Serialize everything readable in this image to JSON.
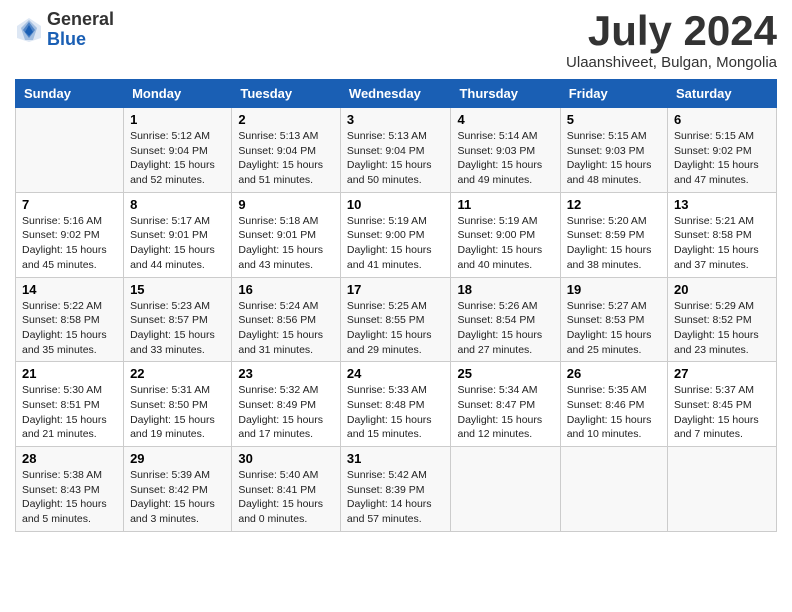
{
  "header": {
    "logo_line1": "General",
    "logo_line2": "Blue",
    "month": "July 2024",
    "location": "Ulaanshiveet, Bulgan, Mongolia"
  },
  "weekdays": [
    "Sunday",
    "Monday",
    "Tuesday",
    "Wednesday",
    "Thursday",
    "Friday",
    "Saturday"
  ],
  "weeks": [
    [
      {
        "num": "",
        "sunrise": "",
        "sunset": "",
        "daylight": "",
        "empty": true
      },
      {
        "num": "1",
        "sunrise": "Sunrise: 5:12 AM",
        "sunset": "Sunset: 9:04 PM",
        "daylight": "Daylight: 15 hours and 52 minutes."
      },
      {
        "num": "2",
        "sunrise": "Sunrise: 5:13 AM",
        "sunset": "Sunset: 9:04 PM",
        "daylight": "Daylight: 15 hours and 51 minutes."
      },
      {
        "num": "3",
        "sunrise": "Sunrise: 5:13 AM",
        "sunset": "Sunset: 9:04 PM",
        "daylight": "Daylight: 15 hours and 50 minutes."
      },
      {
        "num": "4",
        "sunrise": "Sunrise: 5:14 AM",
        "sunset": "Sunset: 9:03 PM",
        "daylight": "Daylight: 15 hours and 49 minutes."
      },
      {
        "num": "5",
        "sunrise": "Sunrise: 5:15 AM",
        "sunset": "Sunset: 9:03 PM",
        "daylight": "Daylight: 15 hours and 48 minutes."
      },
      {
        "num": "6",
        "sunrise": "Sunrise: 5:15 AM",
        "sunset": "Sunset: 9:02 PM",
        "daylight": "Daylight: 15 hours and 47 minutes."
      }
    ],
    [
      {
        "num": "7",
        "sunrise": "Sunrise: 5:16 AM",
        "sunset": "Sunset: 9:02 PM",
        "daylight": "Daylight: 15 hours and 45 minutes."
      },
      {
        "num": "8",
        "sunrise": "Sunrise: 5:17 AM",
        "sunset": "Sunset: 9:01 PM",
        "daylight": "Daylight: 15 hours and 44 minutes."
      },
      {
        "num": "9",
        "sunrise": "Sunrise: 5:18 AM",
        "sunset": "Sunset: 9:01 PM",
        "daylight": "Daylight: 15 hours and 43 minutes."
      },
      {
        "num": "10",
        "sunrise": "Sunrise: 5:19 AM",
        "sunset": "Sunset: 9:00 PM",
        "daylight": "Daylight: 15 hours and 41 minutes."
      },
      {
        "num": "11",
        "sunrise": "Sunrise: 5:19 AM",
        "sunset": "Sunset: 9:00 PM",
        "daylight": "Daylight: 15 hours and 40 minutes."
      },
      {
        "num": "12",
        "sunrise": "Sunrise: 5:20 AM",
        "sunset": "Sunset: 8:59 PM",
        "daylight": "Daylight: 15 hours and 38 minutes."
      },
      {
        "num": "13",
        "sunrise": "Sunrise: 5:21 AM",
        "sunset": "Sunset: 8:58 PM",
        "daylight": "Daylight: 15 hours and 37 minutes."
      }
    ],
    [
      {
        "num": "14",
        "sunrise": "Sunrise: 5:22 AM",
        "sunset": "Sunset: 8:58 PM",
        "daylight": "Daylight: 15 hours and 35 minutes."
      },
      {
        "num": "15",
        "sunrise": "Sunrise: 5:23 AM",
        "sunset": "Sunset: 8:57 PM",
        "daylight": "Daylight: 15 hours and 33 minutes."
      },
      {
        "num": "16",
        "sunrise": "Sunrise: 5:24 AM",
        "sunset": "Sunset: 8:56 PM",
        "daylight": "Daylight: 15 hours and 31 minutes."
      },
      {
        "num": "17",
        "sunrise": "Sunrise: 5:25 AM",
        "sunset": "Sunset: 8:55 PM",
        "daylight": "Daylight: 15 hours and 29 minutes."
      },
      {
        "num": "18",
        "sunrise": "Sunrise: 5:26 AM",
        "sunset": "Sunset: 8:54 PM",
        "daylight": "Daylight: 15 hours and 27 minutes."
      },
      {
        "num": "19",
        "sunrise": "Sunrise: 5:27 AM",
        "sunset": "Sunset: 8:53 PM",
        "daylight": "Daylight: 15 hours and 25 minutes."
      },
      {
        "num": "20",
        "sunrise": "Sunrise: 5:29 AM",
        "sunset": "Sunset: 8:52 PM",
        "daylight": "Daylight: 15 hours and 23 minutes."
      }
    ],
    [
      {
        "num": "21",
        "sunrise": "Sunrise: 5:30 AM",
        "sunset": "Sunset: 8:51 PM",
        "daylight": "Daylight: 15 hours and 21 minutes."
      },
      {
        "num": "22",
        "sunrise": "Sunrise: 5:31 AM",
        "sunset": "Sunset: 8:50 PM",
        "daylight": "Daylight: 15 hours and 19 minutes."
      },
      {
        "num": "23",
        "sunrise": "Sunrise: 5:32 AM",
        "sunset": "Sunset: 8:49 PM",
        "daylight": "Daylight: 15 hours and 17 minutes."
      },
      {
        "num": "24",
        "sunrise": "Sunrise: 5:33 AM",
        "sunset": "Sunset: 8:48 PM",
        "daylight": "Daylight: 15 hours and 15 minutes."
      },
      {
        "num": "25",
        "sunrise": "Sunrise: 5:34 AM",
        "sunset": "Sunset: 8:47 PM",
        "daylight": "Daylight: 15 hours and 12 minutes."
      },
      {
        "num": "26",
        "sunrise": "Sunrise: 5:35 AM",
        "sunset": "Sunset: 8:46 PM",
        "daylight": "Daylight: 15 hours and 10 minutes."
      },
      {
        "num": "27",
        "sunrise": "Sunrise: 5:37 AM",
        "sunset": "Sunset: 8:45 PM",
        "daylight": "Daylight: 15 hours and 7 minutes."
      }
    ],
    [
      {
        "num": "28",
        "sunrise": "Sunrise: 5:38 AM",
        "sunset": "Sunset: 8:43 PM",
        "daylight": "Daylight: 15 hours and 5 minutes."
      },
      {
        "num": "29",
        "sunrise": "Sunrise: 5:39 AM",
        "sunset": "Sunset: 8:42 PM",
        "daylight": "Daylight: 15 hours and 3 minutes."
      },
      {
        "num": "30",
        "sunrise": "Sunrise: 5:40 AM",
        "sunset": "Sunset: 8:41 PM",
        "daylight": "Daylight: 15 hours and 0 minutes."
      },
      {
        "num": "31",
        "sunrise": "Sunrise: 5:42 AM",
        "sunset": "Sunset: 8:39 PM",
        "daylight": "Daylight: 14 hours and 57 minutes."
      },
      {
        "num": "",
        "sunrise": "",
        "sunset": "",
        "daylight": "",
        "empty": true
      },
      {
        "num": "",
        "sunrise": "",
        "sunset": "",
        "daylight": "",
        "empty": true
      },
      {
        "num": "",
        "sunrise": "",
        "sunset": "",
        "daylight": "",
        "empty": true
      }
    ]
  ]
}
